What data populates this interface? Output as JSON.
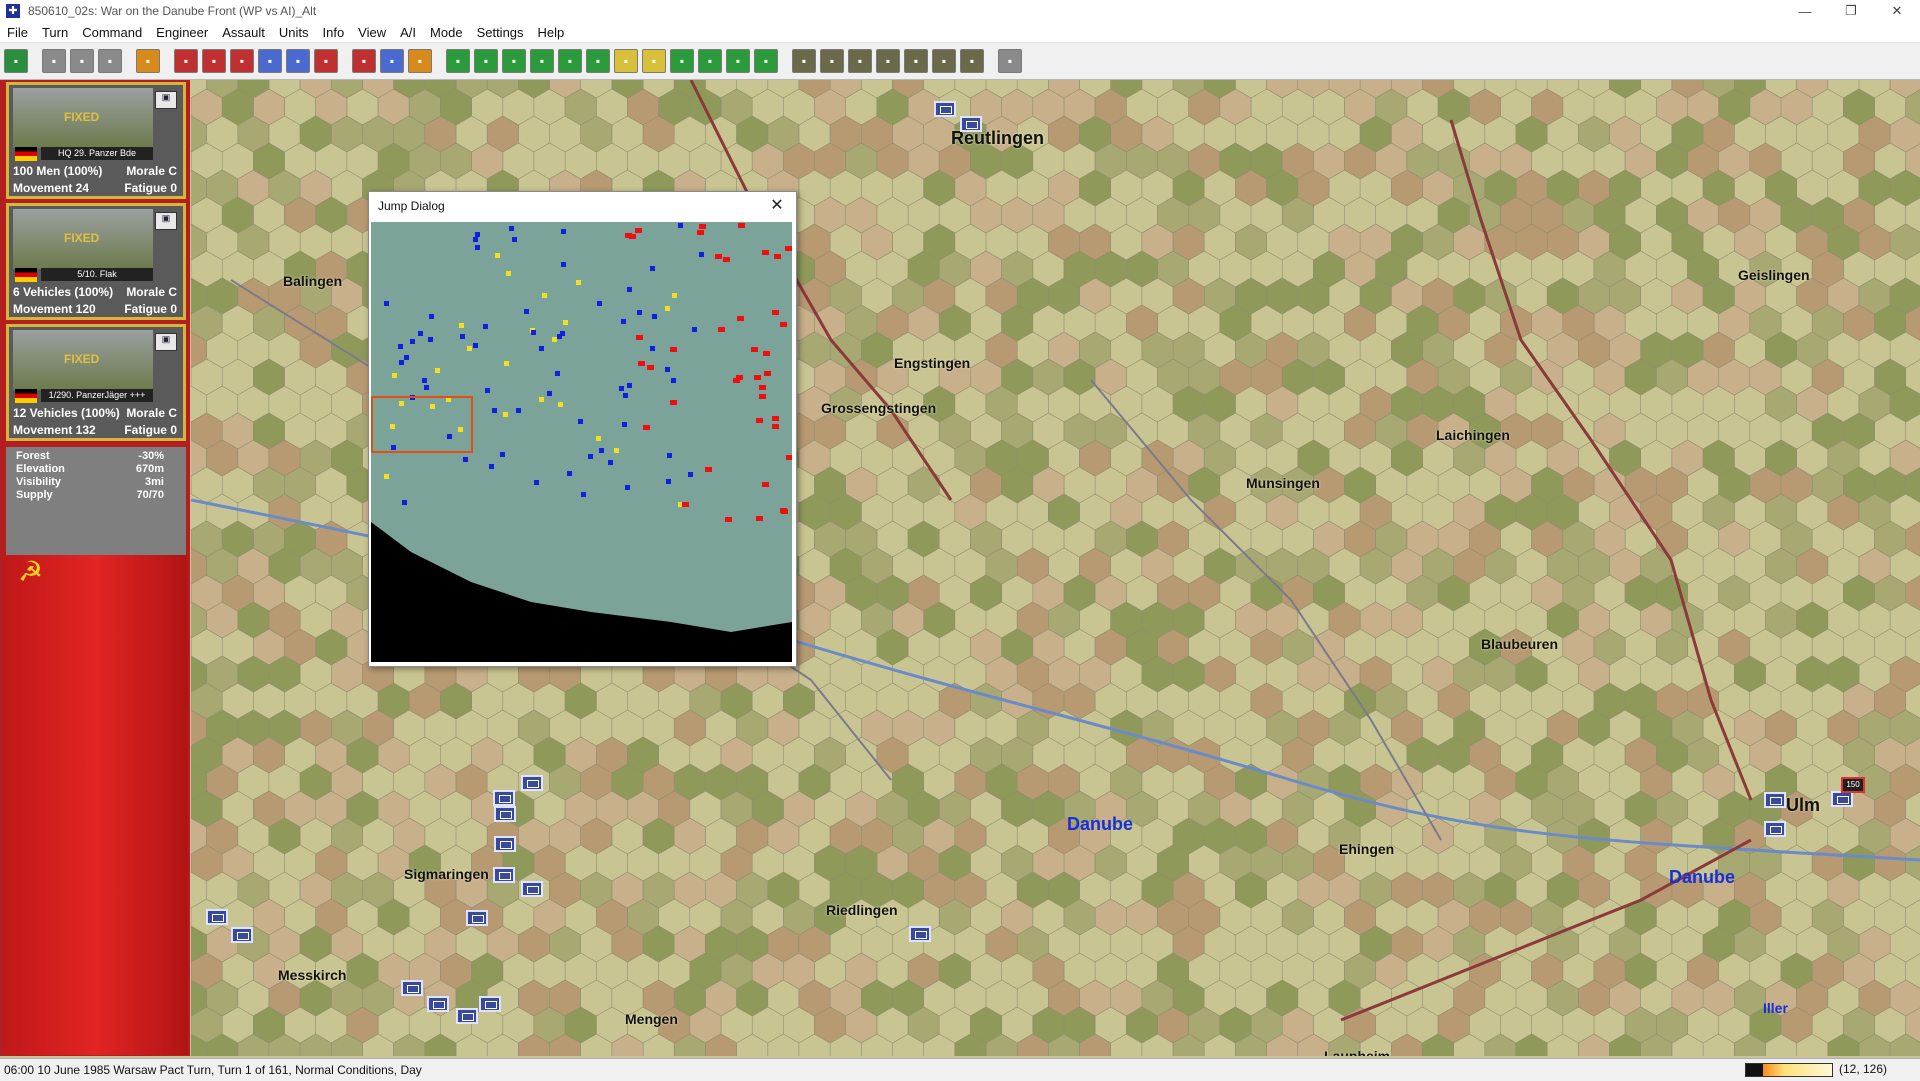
{
  "window": {
    "title": "850610_02s: War on the Danube Front (WP vs AI)_Alt",
    "controls": [
      "—",
      "❐",
      "✕"
    ]
  },
  "menu": [
    "File",
    "Turn",
    "Command",
    "Engineer",
    "Assault",
    "Units",
    "Info",
    "View",
    "A/I",
    "Mode",
    "Settings",
    "Help"
  ],
  "toolbar": {
    "groups": [
      [
        {
          "icon": "target-icon",
          "color": "#2a8f3a"
        }
      ],
      [
        {
          "icon": "clear-icon",
          "color": "#8a8a8a"
        },
        {
          "icon": "folder-icon",
          "color": "#8a8a8a"
        },
        {
          "icon": "save-icon",
          "color": "#8a8a8a"
        }
      ],
      [
        {
          "icon": "unit-info-icon",
          "color": "#d88a1a"
        }
      ],
      [
        {
          "icon": "heart-icon",
          "color": "#c03030"
        },
        {
          "icon": "strength-icon",
          "color": "#c03030"
        },
        {
          "icon": "attack-icon",
          "color": "#c03030"
        },
        {
          "icon": "arrow-right-icon",
          "color": "#4a6ad0"
        },
        {
          "icon": "crossed-swords-icon",
          "color": "#4a6ad0"
        },
        {
          "icon": "list-icon",
          "color": "#c03030"
        }
      ],
      [
        {
          "icon": "no-move-icon",
          "color": "#c03030"
        },
        {
          "icon": "globe-icon",
          "color": "#4a6ad0"
        },
        {
          "icon": "scroll-icon",
          "color": "#d88a1a"
        }
      ],
      [
        {
          "icon": "zoom-in-icon",
          "color": "#2a9a3a"
        },
        {
          "icon": "zoom-out-icon",
          "color": "#2a9a3a"
        },
        {
          "icon": "hex-grid-icon",
          "color": "#2a9a3a"
        },
        {
          "icon": "frame-icon",
          "color": "#2a9a3a"
        },
        {
          "icon": "terrain-icon",
          "color": "#2a9a3a"
        },
        {
          "icon": "flag-icon",
          "color": "#2a9a3a"
        },
        {
          "icon": "unit-bar-icon",
          "color": "#d8c03a"
        },
        {
          "icon": "objective-icon",
          "color": "#d8c03a"
        },
        {
          "icon": "layer-icon",
          "color": "#2a9a3a"
        },
        {
          "icon": "monitor-icon",
          "color": "#2a9a3a"
        },
        {
          "icon": "map-icon",
          "color": "#2a9a3a"
        },
        {
          "icon": "jump-map-icon",
          "color": "#2a9a3a"
        }
      ],
      [
        {
          "icon": "lock-icon",
          "color": "#6a6a4a"
        },
        {
          "icon": "binoculars-icon",
          "color": "#6a6a4a"
        },
        {
          "icon": "unit-u-icon",
          "color": "#6a6a4a"
        },
        {
          "icon": "circle-icon",
          "color": "#6a6a4a"
        },
        {
          "icon": "bridge-icon",
          "color": "#6a6a4a"
        },
        {
          "icon": "org-chart-icon",
          "color": "#6a6a4a"
        },
        {
          "icon": "book-icon",
          "color": "#6a6a4a"
        }
      ],
      [
        {
          "icon": "help-icon",
          "color": "#8a8a8a"
        }
      ]
    ]
  },
  "units": [
    {
      "status": "FIXED",
      "name": "HQ 29. Panzer Bde",
      "strength": "100 Men (100%)",
      "morale": "Morale C",
      "movement": "Movement 24",
      "fatigue": "Fatigue 0"
    },
    {
      "status": "FIXED",
      "name": "5/10. Flak",
      "strength": "6 Vehicles (100%)",
      "morale": "Morale C",
      "movement": "Movement 120",
      "fatigue": "Fatigue 0"
    },
    {
      "status": "FIXED",
      "name": "1/290. PanzerJäger +++",
      "strength": "12 Vehicles (100%)",
      "morale": "Morale C",
      "movement": "Movement 132",
      "fatigue": "Fatigue 0"
    }
  ],
  "terrain": {
    "rows": [
      {
        "label": "Forest",
        "value": "-30%"
      },
      {
        "label": "Elevation",
        "value": "670m"
      },
      {
        "label": "Visibility",
        "value": "3mi"
      },
      {
        "label": "Supply",
        "value": "70/70"
      }
    ]
  },
  "map": {
    "cities": [
      {
        "name": "Reutlingen",
        "large": true
      },
      {
        "name": "Balingen"
      },
      {
        "name": "Engstingen"
      },
      {
        "name": "Grossengstingen"
      },
      {
        "name": "Geislingen"
      },
      {
        "name": "Laichingen"
      },
      {
        "name": "Munsingen"
      },
      {
        "name": "Blaubeuren"
      },
      {
        "name": "Ulm",
        "large": true
      },
      {
        "name": "Ehingen"
      },
      {
        "name": "Sigmaringen"
      },
      {
        "name": "Riedlingen"
      },
      {
        "name": "Messkirch"
      },
      {
        "name": "Mengen"
      },
      {
        "name": "Laupheim"
      }
    ],
    "rivers": [
      {
        "name": "Danube"
      },
      {
        "name": "Danube"
      },
      {
        "name": "Iller",
        "small": true
      }
    ],
    "wp_unit_label": "150"
  },
  "dialog": {
    "title": "Jump Dialog",
    "close": "✕"
  },
  "status": {
    "text": "06:00 10 June 1985 Warsaw Pact Turn, Turn 1 of 161, Normal Conditions, Day",
    "coords": "(12, 126)"
  }
}
